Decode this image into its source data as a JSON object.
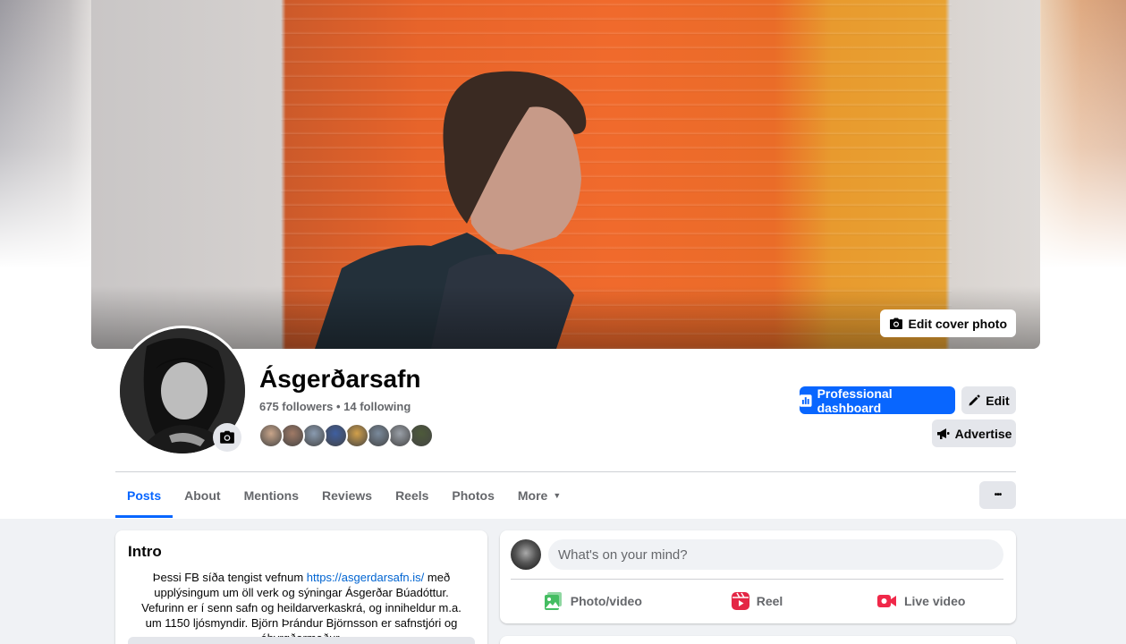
{
  "cover": {
    "edit_label": "Edit cover photo"
  },
  "profile": {
    "name": "Ásgerðarsafn",
    "followers_line": "675 followers • 14 following",
    "follower_avatar_colors": [
      "#c9a58a",
      "#a07a66",
      "#8a9bb0",
      "#3f5fa0",
      "#d2a04a",
      "#7a8a9c",
      "#9aa0a8",
      "#4d5a3a"
    ]
  },
  "actions": {
    "dashboard_label": "Professional dashboard",
    "edit_label": "Edit",
    "advertise_label": "Advertise"
  },
  "tabs": [
    {
      "label": "Posts",
      "active": true
    },
    {
      "label": "About"
    },
    {
      "label": "Mentions"
    },
    {
      "label": "Reviews"
    },
    {
      "label": "Reels"
    },
    {
      "label": "Photos"
    },
    {
      "label": "More"
    }
  ],
  "more_menu_label": "•••",
  "intro": {
    "title": "Intro",
    "text_before_link": "Þessi FB síða tengist vefnum ",
    "link": "https://asgerdarsafn.is/",
    "text_after_link": " með upplýsingum um öll verk og sýningar Ásgerðar Búadóttur. Vefurinn er í senn safn og heildarverkaskrá, og inniheldur m.a. um 1150 ljósmyndir. Björn Þrándur Björnsson er safnstjóri og ábyrgðarmaður."
  },
  "composer": {
    "placeholder": "What's on your mind?",
    "photo_label": "Photo/video",
    "reel_label": "Reel",
    "live_label": "Live video"
  },
  "colors": {
    "accent": "#0866ff",
    "photo_icon": "#45bd62",
    "reel_icon": "#e42645",
    "live_icon": "#f02849"
  }
}
